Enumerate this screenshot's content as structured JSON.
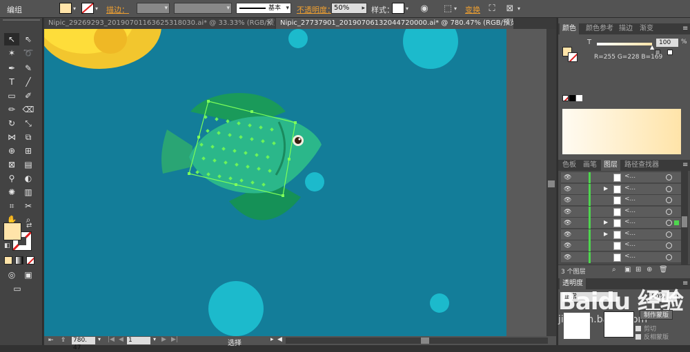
{
  "app_menu": {
    "group_label": "编组"
  },
  "control_bar": {
    "fill_color": "#ffe4a9",
    "stroke_label": "描边：",
    "stroke_style": "基本",
    "opacity_label": "不透明度：",
    "opacity_value": "50%",
    "style_label": "样式：",
    "transform_label": "变换"
  },
  "tabs": [
    {
      "label": "Nipic_29269293_20190701163625318030.ai* @ 33.33% (RGB/预览)",
      "active": false
    },
    {
      "label": "Nipic_27737901_20190706132044720000.ai* @ 780.47% (RGB/预览)",
      "active": true
    }
  ],
  "tab_close": "×",
  "toolbox": {
    "fill_color": "#ffe4a9"
  },
  "statusbar": {
    "zoom": "780. 47",
    "page": "1",
    "mode": "选择"
  },
  "color_panel": {
    "tabs": [
      "颜色",
      "颜色参考",
      "描边",
      "渐变"
    ],
    "channel_label": "T",
    "channel_value": "100",
    "unit": "%",
    "rgb_readout": "R=255  G=228  B=169"
  },
  "layers_panel": {
    "tabs": [
      "色板",
      "画笔",
      "图层",
      "路径查找器"
    ],
    "rows": [
      {
        "name": "<...",
        "expand": false,
        "selected": false
      },
      {
        "name": "<...",
        "expand": true,
        "selected": false
      },
      {
        "name": "<...",
        "expand": false,
        "selected": false
      },
      {
        "name": "<...",
        "expand": false,
        "selected": false
      },
      {
        "name": "<...",
        "expand": true,
        "selected": true
      },
      {
        "name": "<...",
        "expand": true,
        "selected": false
      },
      {
        "name": "<...",
        "expand": false,
        "selected": false
      },
      {
        "name": "<...",
        "expand": false,
        "selected": false
      }
    ],
    "footer_count": "3 个图层"
  },
  "transparency_panel": {
    "title": "透明度",
    "mode_value": "正常",
    "opacity_value": "50%",
    "make_mask_button": "制作蒙版",
    "clip_label": "剪切",
    "invert_label": "反相蒙版",
    "watermark": "Baidu 经验",
    "watermark_url": "jingyan.baidu.com"
  },
  "colors": {
    "artboard_bg": "#137d99",
    "bubble": "#1cbacc",
    "fish_body": "#2bb78a",
    "fish_fin": "#1a9a5a",
    "selection": "#7dff5a"
  }
}
